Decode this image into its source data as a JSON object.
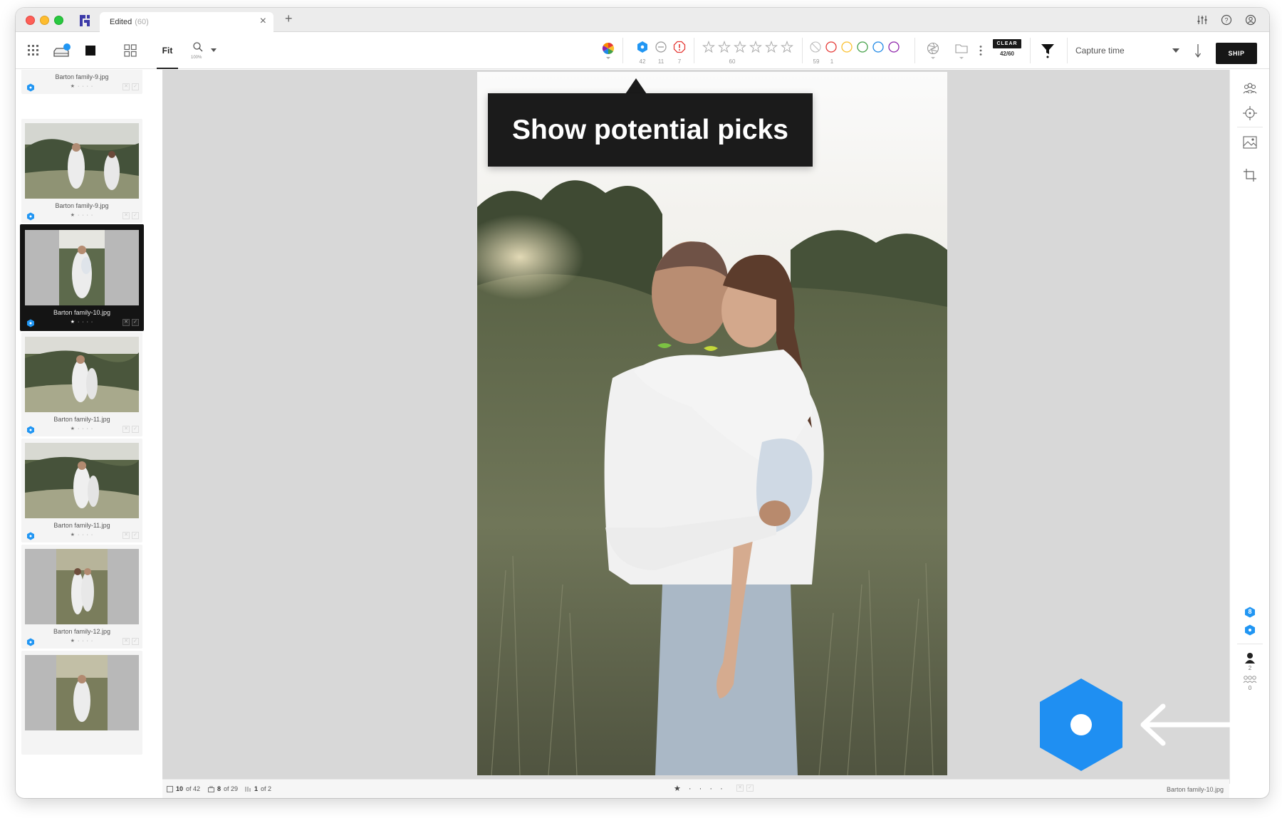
{
  "titlebar": {
    "tab_title": "Edited",
    "tab_count": "(60)",
    "close_glyph": "×",
    "add_glyph": "+"
  },
  "toolbar": {
    "fit_label": "Fit",
    "zoom_level": "100%",
    "potential_picks_count": "42",
    "neutral_count": "11",
    "warning_count": "7",
    "stars_count": "60",
    "nocolor_count": "59",
    "red_count": "1",
    "clear_label": "CLEAR",
    "clear_count": "42/60",
    "sort_label": "Capture time",
    "ship_label": "SHIP",
    "accent_color": "#2196f3"
  },
  "tooltip": {
    "text": "Show potential picks"
  },
  "filmstrip": {
    "items": [
      {
        "name": "Barton family-9.jpg",
        "stars": "★ · · · ·",
        "x": "✕",
        "ok": "✓"
      },
      {
        "name": "Barton family-9.jpg",
        "stars": "★ · · · ·",
        "x": "✕",
        "ok": "✓"
      },
      {
        "name": "Barton family-10.jpg",
        "stars": "★ · · · ·",
        "x": "✕",
        "ok": "✓"
      },
      {
        "name": "Barton family-11.jpg",
        "stars": "★ · · · ·",
        "x": "✕",
        "ok": "✓"
      },
      {
        "name": "Barton family-11.jpg",
        "stars": "★ · · · ·",
        "x": "✕",
        "ok": "✓"
      },
      {
        "name": "Barton family-12.jpg",
        "stars": "★ · · · ·",
        "x": "✕",
        "ok": "✓"
      }
    ]
  },
  "rightrail": {
    "badge_count": "8",
    "people_count": "2",
    "group_count": "0"
  },
  "statusbar": {
    "position": "10",
    "position_of": "of 42",
    "stack": "8",
    "stack_of": "of 29",
    "page": "1",
    "page_of": "of 2",
    "stars": "★ · · · ·",
    "filename": "Barton family-10.jpg",
    "x": "✕",
    "ok": "✓"
  }
}
